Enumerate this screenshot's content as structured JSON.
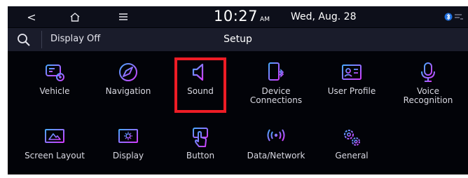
{
  "status_bar": {
    "back": "<",
    "time": "10:27",
    "ampm": "AM",
    "date": "Wed, Aug. 28"
  },
  "header": {
    "display_off": "Display Off",
    "title": "Setup"
  },
  "menu": {
    "items": [
      {
        "label": "Vehicle",
        "icon": "vehicle-icon"
      },
      {
        "label": "Navigation",
        "icon": "compass-icon"
      },
      {
        "label": "Sound",
        "icon": "speaker-icon",
        "selected": true
      },
      {
        "label": "Device\nConnections",
        "icon": "phone-connection-icon"
      },
      {
        "label": "User Profile",
        "icon": "user-card-icon"
      },
      {
        "label": "Voice\nRecognition",
        "icon": "microphone-icon"
      },
      {
        "label": "Screen Layout",
        "icon": "screen-layout-icon"
      },
      {
        "label": "Display",
        "icon": "brightness-icon"
      },
      {
        "label": "Button",
        "icon": "touch-button-icon"
      },
      {
        "label": "Data/Network",
        "icon": "antenna-icon"
      },
      {
        "label": "General",
        "icon": "gears-icon"
      }
    ]
  },
  "colors": {
    "icon_gradient_start": "#4aa8ff",
    "icon_gradient_end": "#d03cff",
    "highlight": "#ee1c25",
    "background": "#020308"
  }
}
